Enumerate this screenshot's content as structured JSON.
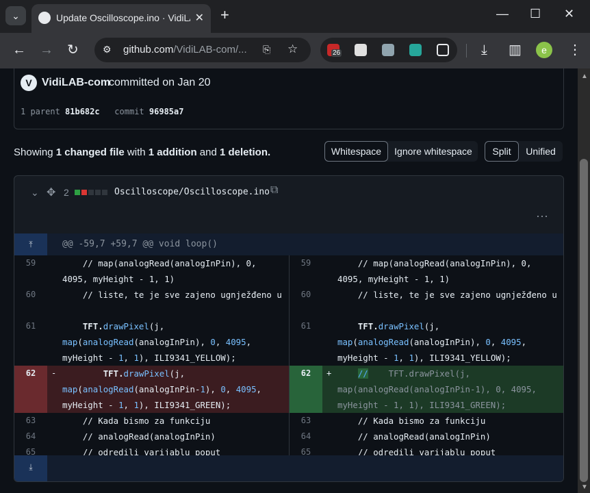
{
  "browser": {
    "tab_title": "Update Oscilloscope.ino · VidiLAB-com/Oscilloscope",
    "url_host": "github.com",
    "url_path": "/VidiLAB-com/...",
    "ext_badge": "26",
    "avatar_letter": "e"
  },
  "commit": {
    "author": "VidiLAB-com",
    "action": "committed on Jan 20",
    "parent_label": "1 parent",
    "parent_sha": "81b682c",
    "commit_label": "commit",
    "commit_sha": "96985a7"
  },
  "summary": {
    "showing": "Showing",
    "changed": "1 changed file",
    "with": "with",
    "additions": "1 addition",
    "and": "and",
    "deletions": "1 deletion."
  },
  "buttons": {
    "whitespace": "Whitespace",
    "ignore_whitespace": "Ignore whitespace",
    "split": "Split",
    "unified": "Unified"
  },
  "file": {
    "changes": "2",
    "name": "Oscilloscope/Oscilloscope.ino",
    "hunk_header": "@@ -59,7 +59,7 @@ void loop()"
  },
  "diff": {
    "left": [
      {
        "num": "59",
        "type": "ctx",
        "lines": 2
      },
      {
        "num": "60",
        "type": "ctx",
        "lines": 2
      },
      {
        "num": "61",
        "type": "ctx",
        "lines": 3
      },
      {
        "num": "62",
        "type": "del",
        "lines": 3
      },
      {
        "num": "63",
        "type": "ctx",
        "lines": 1
      },
      {
        "num": "64",
        "type": "ctx",
        "lines": 1
      },
      {
        "num": "65",
        "type": "ctx",
        "lines": 1
      }
    ],
    "right": [
      {
        "num": "59",
        "type": "ctx",
        "lines": 2
      },
      {
        "num": "60",
        "type": "ctx",
        "lines": 2
      },
      {
        "num": "61",
        "type": "ctx",
        "lines": 3
      },
      {
        "num": "62",
        "type": "add",
        "lines": 3
      },
      {
        "num": "63",
        "type": "ctx",
        "lines": 1
      },
      {
        "num": "64",
        "type": "ctx",
        "lines": 1
      },
      {
        "num": "65",
        "type": "ctx",
        "lines": 1
      }
    ],
    "code": {
      "c59": "    // map(analogRead(analogInPin), 0, 4095, myHeight - 1, 1)",
      "c60": "    // liste, te je sve zajeno ugnježđeno u",
      "c63": "    // Kada bismo za funkciju",
      "c64": "    // analogRead(analogInPin)",
      "c65": "    // odredili varijablu poput",
      "tft": "TFT.",
      "drawPixel": "drawPixel",
      "map": "map",
      "analogRead": "analogRead",
      "pin61": "(analogInPin), ",
      "zero": "0",
      "n4095": "4095",
      "height": "myHeight - ",
      "one": "1",
      "yellow_tail": "), ILI9341_YELLOW);",
      "j_open": "(j,",
      "pin62": "(analogInPin-",
      "green_tail": "), ILI9341_GREEN);",
      "add_comment": "//",
      "add_rest": "    TFT.drawPixel(j, map(analogRead(analogInPin-1), 0, 4095, myHeight - 1, 1), ILI9341_GREEN);",
      "minus": "-",
      "plus": "+"
    }
  },
  "colors": {
    "del_bg": "#3b1c20",
    "add_bg": "#1c3a26",
    "accent_blue": "#79c0ff"
  }
}
